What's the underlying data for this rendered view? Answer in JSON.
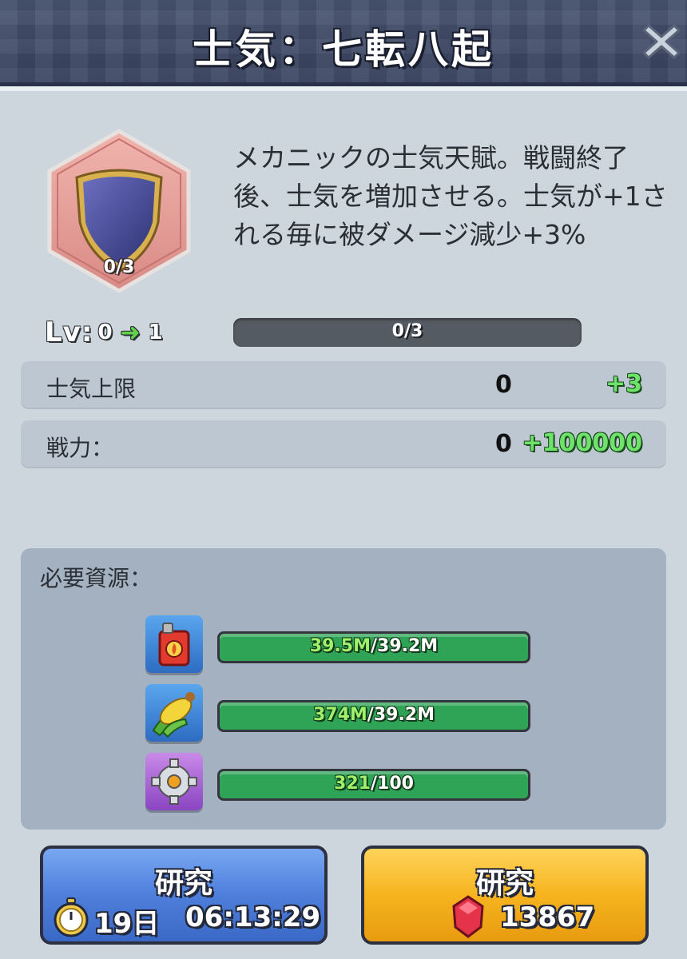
{
  "header": {
    "title": "士気：七転八起"
  },
  "talent": {
    "badge_count": "0/3",
    "description": "メカニックの士気天賦。戦闘終了後、士気を増加させる。士気が+1される毎に被ダメージ減少+3%",
    "level_label": "Lv:",
    "level_current": "0",
    "level_next": "1",
    "progress_text": "0/3",
    "progress_fraction": 0
  },
  "stats": [
    {
      "label": "士気上限",
      "current": "0",
      "increase": "+3"
    },
    {
      "label": "戦力：",
      "current": "0",
      "increase": "+100000"
    }
  ],
  "resources": {
    "title": "必要資源：",
    "items": [
      {
        "icon": "fuel-can-icon",
        "have": "39.5M",
        "need": "/39.2M"
      },
      {
        "icon": "corn-icon",
        "have": "374M",
        "need": "/39.2M"
      },
      {
        "icon": "gear-icon",
        "have": "321",
        "need": "/100"
      }
    ]
  },
  "buttons": {
    "research_timer": {
      "label": "研究",
      "days": "19日",
      "time": "06:13:29"
    },
    "research_gems": {
      "label": "研究",
      "cost": "13867"
    }
  },
  "colors": {
    "header_bg": "#3f4a66",
    "panel_bg": "#cdd6dd",
    "increase_green": "#6ee36a",
    "button_blue": "#4f80dc",
    "button_yellow": "#f6b41f",
    "bar_green": "#2fa356"
  }
}
